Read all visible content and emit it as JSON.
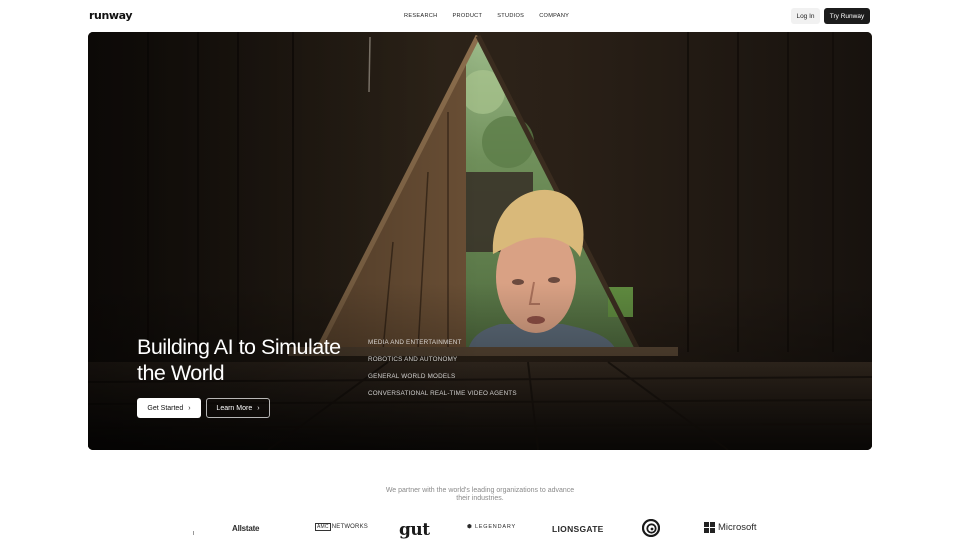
{
  "header": {
    "logo": "runway",
    "nav": [
      "RESEARCH",
      "PRODUCT",
      "STUDIOS",
      "COMPANY"
    ],
    "login_label": "Log In",
    "try_label": "Try Runway"
  },
  "hero": {
    "title": "Building AI to Simulate the World",
    "list": [
      "MEDIA AND ENTERTAINMENT",
      "ROBOTICS AND AUTONOMY",
      "GENERAL WORLD MODELS",
      "CONVERSATIONAL REAL-TIME VIDEO AGENTS"
    ],
    "get_started_label": "Get Started",
    "learn_more_label": "Learn More"
  },
  "partners": {
    "text": "We partner with the world's leading organizations to advance their industries.",
    "logos": {
      "allstate": "Allstate",
      "amc_box": "AMC",
      "amc_rest": "NETWORKS",
      "gut": "gut",
      "legendary": "LEGENDARY",
      "lionsgate": "LIONSGATE",
      "ubisoft": "Ubisoft",
      "microsoft": "Microsoft"
    }
  }
}
